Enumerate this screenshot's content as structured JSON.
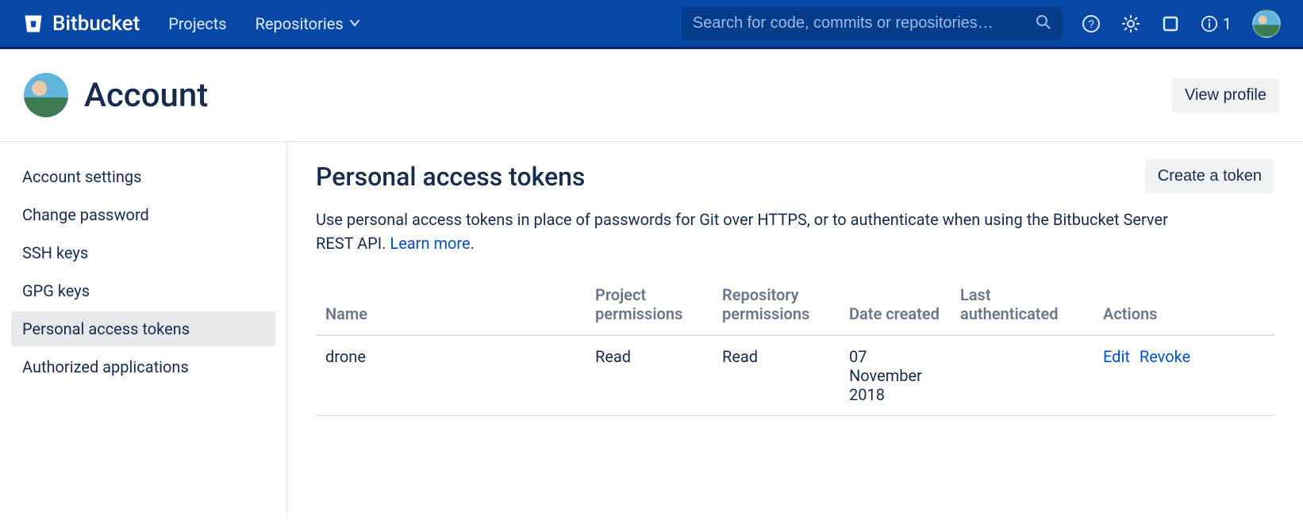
{
  "brand": {
    "name": "Bitbucket"
  },
  "nav": {
    "projects": "Projects",
    "repositories": "Repositories"
  },
  "search": {
    "placeholder": "Search for code, commits or repositories…"
  },
  "topbar": {
    "badge_count": "1"
  },
  "page": {
    "title": "Account",
    "view_profile": "View profile"
  },
  "sidebar": {
    "items": [
      {
        "label": "Account settings",
        "active": false
      },
      {
        "label": "Change password",
        "active": false
      },
      {
        "label": "SSH keys",
        "active": false
      },
      {
        "label": "GPG keys",
        "active": false
      },
      {
        "label": "Personal access tokens",
        "active": true
      },
      {
        "label": "Authorized applications",
        "active": false
      }
    ]
  },
  "main": {
    "title": "Personal access tokens",
    "create_button": "Create a token",
    "description_pre": "Use personal access tokens in place of passwords for Git over HTTPS, or to authenticate when using the Bitbucket Server REST API. ",
    "learn_more": "Learn more",
    "description_post": ".",
    "table": {
      "headers": {
        "name": "Name",
        "project": "Project permissions",
        "repo": "Repository permissions",
        "created": "Date created",
        "auth": "Last authenticated",
        "actions": "Actions"
      },
      "rows": [
        {
          "name": "drone",
          "project": "Read",
          "repo": "Read",
          "created": "07 November 2018",
          "auth": "",
          "edit": "Edit",
          "revoke": "Revoke"
        }
      ]
    }
  }
}
